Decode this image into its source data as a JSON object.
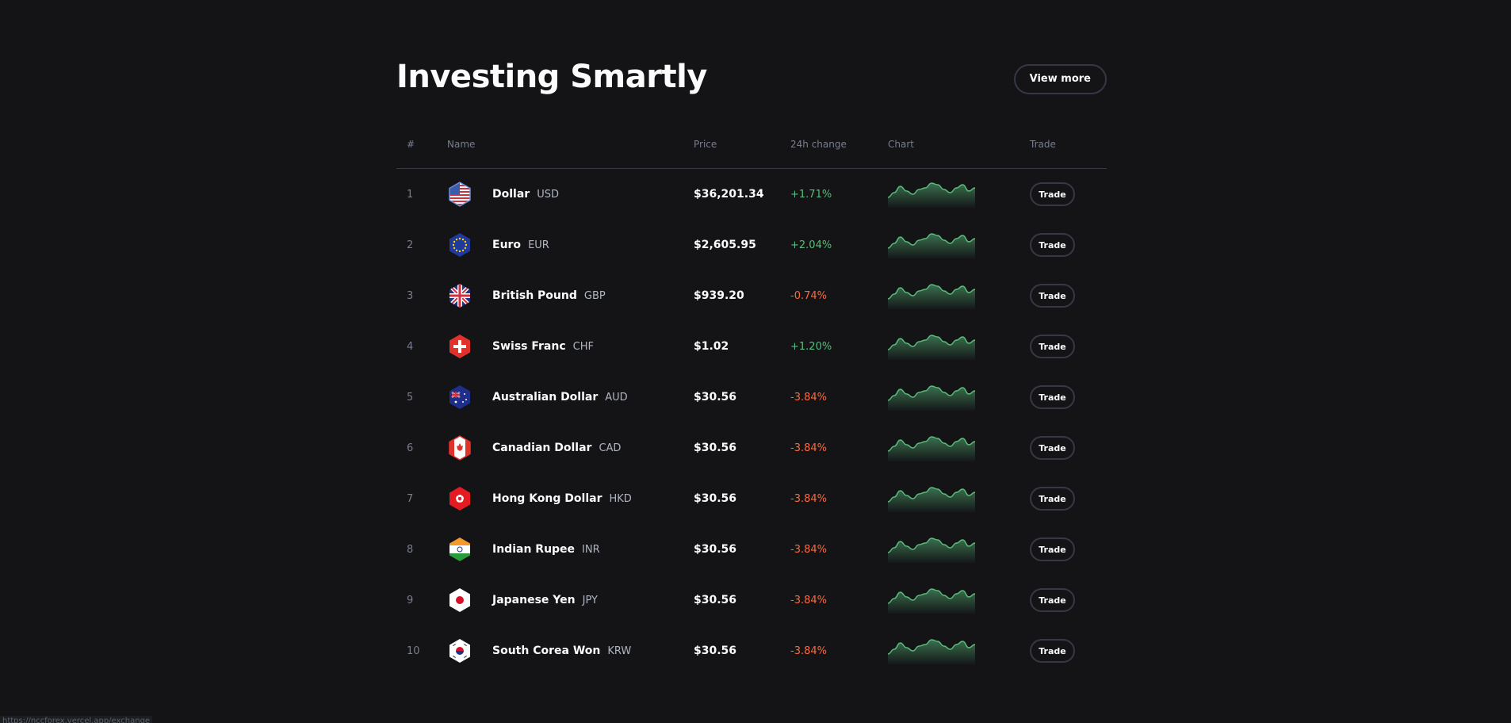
{
  "header": {
    "title": "Investing Smartly",
    "view_more_label": "View more"
  },
  "table": {
    "columns": {
      "num": "#",
      "name": "Name",
      "price": "Price",
      "change": "24h change",
      "chart": "Chart",
      "trade": "Trade"
    },
    "rows": [
      {
        "rank": "1",
        "name": "Dollar",
        "code": "USD",
        "price": "$36,201.34",
        "change": "+1.71%",
        "direction": "up",
        "flag": "us-flag-icon",
        "trade_label": "Trade"
      },
      {
        "rank": "2",
        "name": "Euro",
        "code": "EUR",
        "price": "$2,605.95",
        "change": "+2.04%",
        "direction": "up",
        "flag": "eu-flag-icon",
        "trade_label": "Trade"
      },
      {
        "rank": "3",
        "name": "British Pound",
        "code": "GBP",
        "price": "$939.20",
        "change": "-0.74%",
        "direction": "down",
        "flag": "uk-flag-icon",
        "trade_label": "Trade"
      },
      {
        "rank": "4",
        "name": "Swiss Franc",
        "code": "CHF",
        "price": "$1.02",
        "change": "+1.20%",
        "direction": "up",
        "flag": "ch-flag-icon",
        "trade_label": "Trade"
      },
      {
        "rank": "5",
        "name": "Australian Dollar",
        "code": "AUD",
        "price": "$30.56",
        "change": "-3.84%",
        "direction": "down",
        "flag": "au-flag-icon",
        "trade_label": "Trade"
      },
      {
        "rank": "6",
        "name": "Canadian Dollar",
        "code": "CAD",
        "price": "$30.56",
        "change": "-3.84%",
        "direction": "down",
        "flag": "ca-flag-icon",
        "trade_label": "Trade"
      },
      {
        "rank": "7",
        "name": "Hong Kong Dollar",
        "code": "HKD",
        "price": "$30.56",
        "change": "-3.84%",
        "direction": "down",
        "flag": "hk-flag-icon",
        "trade_label": "Trade"
      },
      {
        "rank": "8",
        "name": "Indian Rupee",
        "code": "INR",
        "price": "$30.56",
        "change": "-3.84%",
        "direction": "down",
        "flag": "in-flag-icon",
        "trade_label": "Trade"
      },
      {
        "rank": "9",
        "name": "Japanese Yen",
        "code": "JPY",
        "price": "$30.56",
        "change": "-3.84%",
        "direction": "down",
        "flag": "jp-flag-icon",
        "trade_label": "Trade"
      },
      {
        "rank": "10",
        "name": "South Corea Won",
        "code": "KRW",
        "price": "$30.56",
        "change": "-3.84%",
        "direction": "down",
        "flag": "kr-flag-icon",
        "trade_label": "Trade"
      }
    ]
  },
  "sparkline": {
    "values": [
      3,
      6,
      10,
      7,
      5,
      8,
      9,
      12,
      11,
      8,
      6,
      9,
      11,
      7,
      9
    ]
  },
  "colors": {
    "background": "#141416",
    "up": "#58bd7d",
    "down": "#ff6838",
    "border": "#353945",
    "muted": "#777e90"
  },
  "status_bar": {
    "url": "https://nccforex.vercel.app/exchange"
  }
}
